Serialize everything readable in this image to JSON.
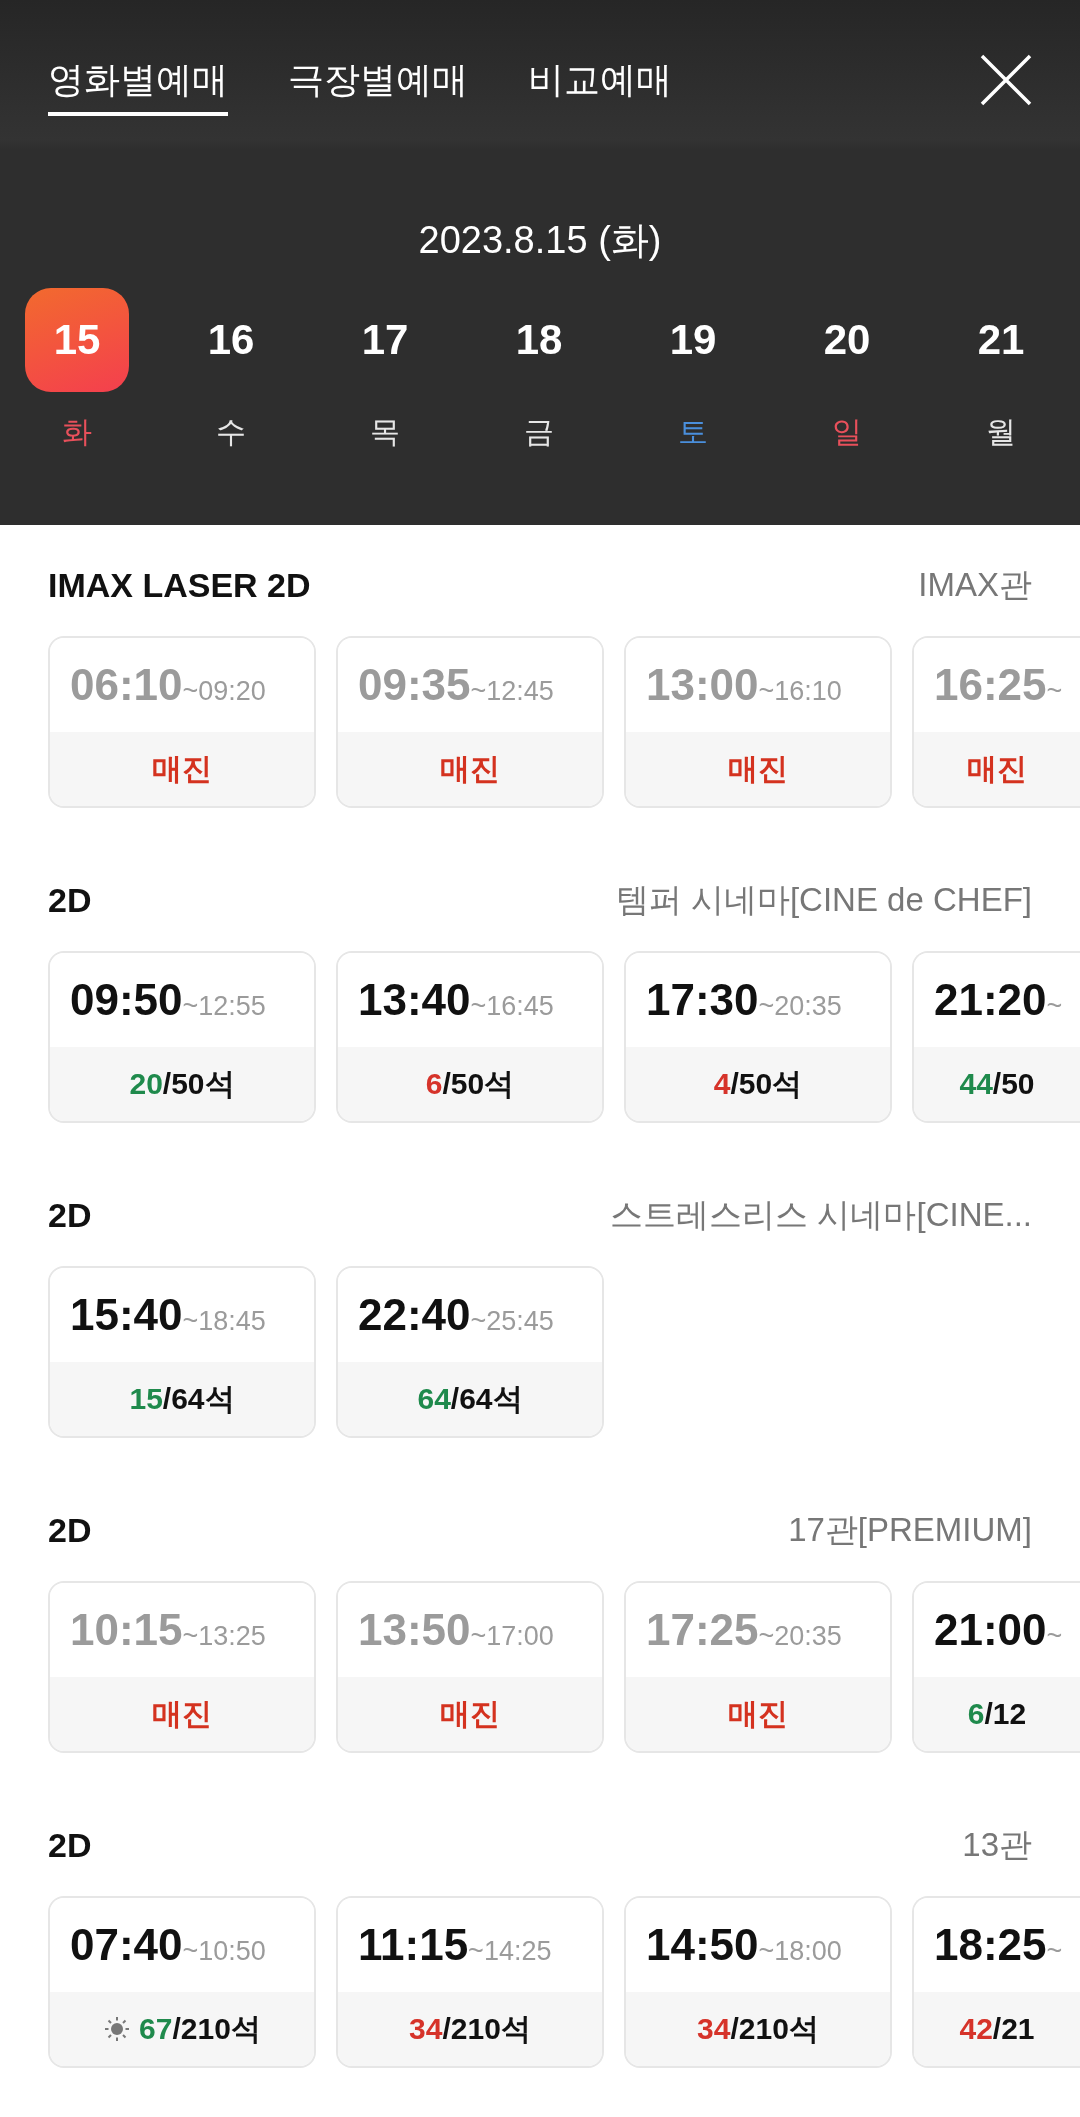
{
  "tabs": [
    {
      "label": "영화별예매",
      "selected": true
    },
    {
      "label": "극장별예매",
      "selected": false
    },
    {
      "label": "비교예매",
      "selected": false
    }
  ],
  "date_title": "2023.8.15 (화)",
  "days": [
    {
      "day": "15",
      "weekday": "화",
      "color": "#e8505b",
      "selected": true
    },
    {
      "day": "16",
      "weekday": "수",
      "color": "#e6e6e6",
      "selected": false
    },
    {
      "day": "17",
      "weekday": "목",
      "color": "#e6e6e6",
      "selected": false
    },
    {
      "day": "18",
      "weekday": "금",
      "color": "#e6e6e6",
      "selected": false
    },
    {
      "day": "19",
      "weekday": "토",
      "color": "#4a8fdc",
      "selected": false
    },
    {
      "day": "20",
      "weekday": "일",
      "color": "#e8505b",
      "selected": false
    },
    {
      "day": "21",
      "weekday": "월",
      "color": "#e6e6e6",
      "selected": false
    }
  ],
  "sections": [
    {
      "format": "IMAX LASER 2D",
      "screen": "IMAX관",
      "showtimes": [
        {
          "start": "06:10",
          "end": "~09:20",
          "sold_out": true,
          "status": "매진"
        },
        {
          "start": "09:35",
          "end": "~12:45",
          "sold_out": true,
          "status": "매진"
        },
        {
          "start": "13:00",
          "end": "~16:10",
          "sold_out": true,
          "status": "매진"
        },
        {
          "start": "16:25",
          "end": "~",
          "sold_out": true,
          "status": "매진"
        }
      ]
    },
    {
      "format": "2D",
      "screen": "템퍼 시네마[CINE de CHEF]",
      "showtimes": [
        {
          "start": "09:50",
          "end": "~12:55",
          "sold_out": false,
          "available": "20",
          "total": "/50석",
          "color": "#1f8a4c"
        },
        {
          "start": "13:40",
          "end": "~16:45",
          "sold_out": false,
          "available": "6",
          "total": "/50석",
          "color": "#d6332a"
        },
        {
          "start": "17:30",
          "end": "~20:35",
          "sold_out": false,
          "available": "4",
          "total": "/50석",
          "color": "#d6332a"
        },
        {
          "start": "21:20",
          "end": "~",
          "sold_out": false,
          "available": "44",
          "total": "/50",
          "color": "#1f8a4c"
        }
      ]
    },
    {
      "format": "2D",
      "screen": "스트레스리스 시네마[CINE...",
      "showtimes": [
        {
          "start": "15:40",
          "end": "~18:45",
          "sold_out": false,
          "available": "15",
          "total": "/64석",
          "color": "#1f8a4c"
        },
        {
          "start": "22:40",
          "end": "~25:45",
          "sold_out": false,
          "available": "64",
          "total": "/64석",
          "color": "#1f8a4c"
        }
      ]
    },
    {
      "format": "2D",
      "screen": "17관[PREMIUM]",
      "showtimes": [
        {
          "start": "10:15",
          "end": "~13:25",
          "sold_out": true,
          "status": "매진"
        },
        {
          "start": "13:50",
          "end": "~17:00",
          "sold_out": true,
          "status": "매진"
        },
        {
          "start": "17:25",
          "end": "~20:35",
          "sold_out": true,
          "status": "매진"
        },
        {
          "start": "21:00",
          "end": "~",
          "sold_out": false,
          "available": "6",
          "total": "/12",
          "color": "#1f8a4c"
        }
      ]
    },
    {
      "format": "2D",
      "screen": "13관",
      "showtimes": [
        {
          "start": "07:40",
          "end": "~10:50",
          "sold_out": false,
          "morning": true,
          "available": "67",
          "total": "/210석",
          "color": "#1f8a4c"
        },
        {
          "start": "11:15",
          "end": "~14:25",
          "sold_out": false,
          "available": "34",
          "total": "/210석",
          "color": "#d6332a"
        },
        {
          "start": "14:50",
          "end": "~18:00",
          "sold_out": false,
          "available": "34",
          "total": "/210석",
          "color": "#d6332a"
        },
        {
          "start": "18:25",
          "end": "~",
          "sold_out": false,
          "available": "42",
          "total": "/21",
          "color": "#d6332a"
        }
      ]
    }
  ]
}
